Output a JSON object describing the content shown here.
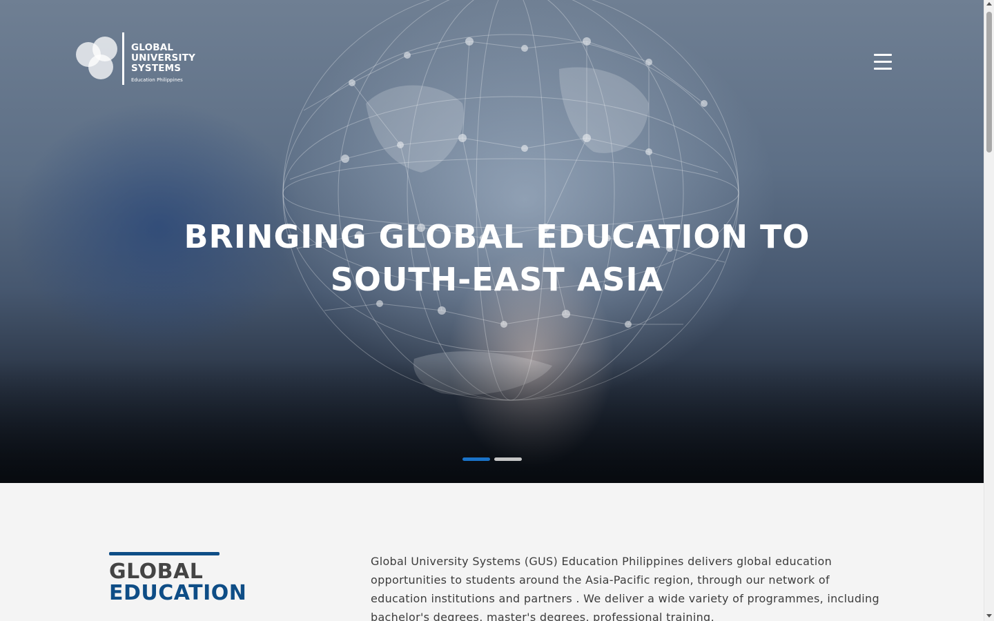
{
  "header": {
    "logo": {
      "line1": "GLOBAL",
      "line2": "UNIVERSITY",
      "line3": "SYSTEMS",
      "subtitle": "Education Philippines"
    },
    "menu_icon": "hamburger-menu-icon"
  },
  "hero": {
    "title_line1": "BRINGING GLOBAL EDUCATION TO",
    "title_line2": "SOUTH-EAST ASIA",
    "slides_count": 2,
    "active_slide": 1
  },
  "intro": {
    "heading_line1": "GLOBAL",
    "heading_line2": "EDUCATION",
    "paragraph": "Global University Systems (GUS) Education Philippines delivers global education opportunities to students around the Asia-Pacific region, through our network of education institutions and partners . We deliver a wide variety of programmes, including bachelor's degrees, master's degrees, professional training,"
  },
  "colors": {
    "accent": "#0e4d86",
    "slider_active": "#1a73c8",
    "slider_inactive": "#c5c5c5",
    "heading_dark": "#444444"
  }
}
